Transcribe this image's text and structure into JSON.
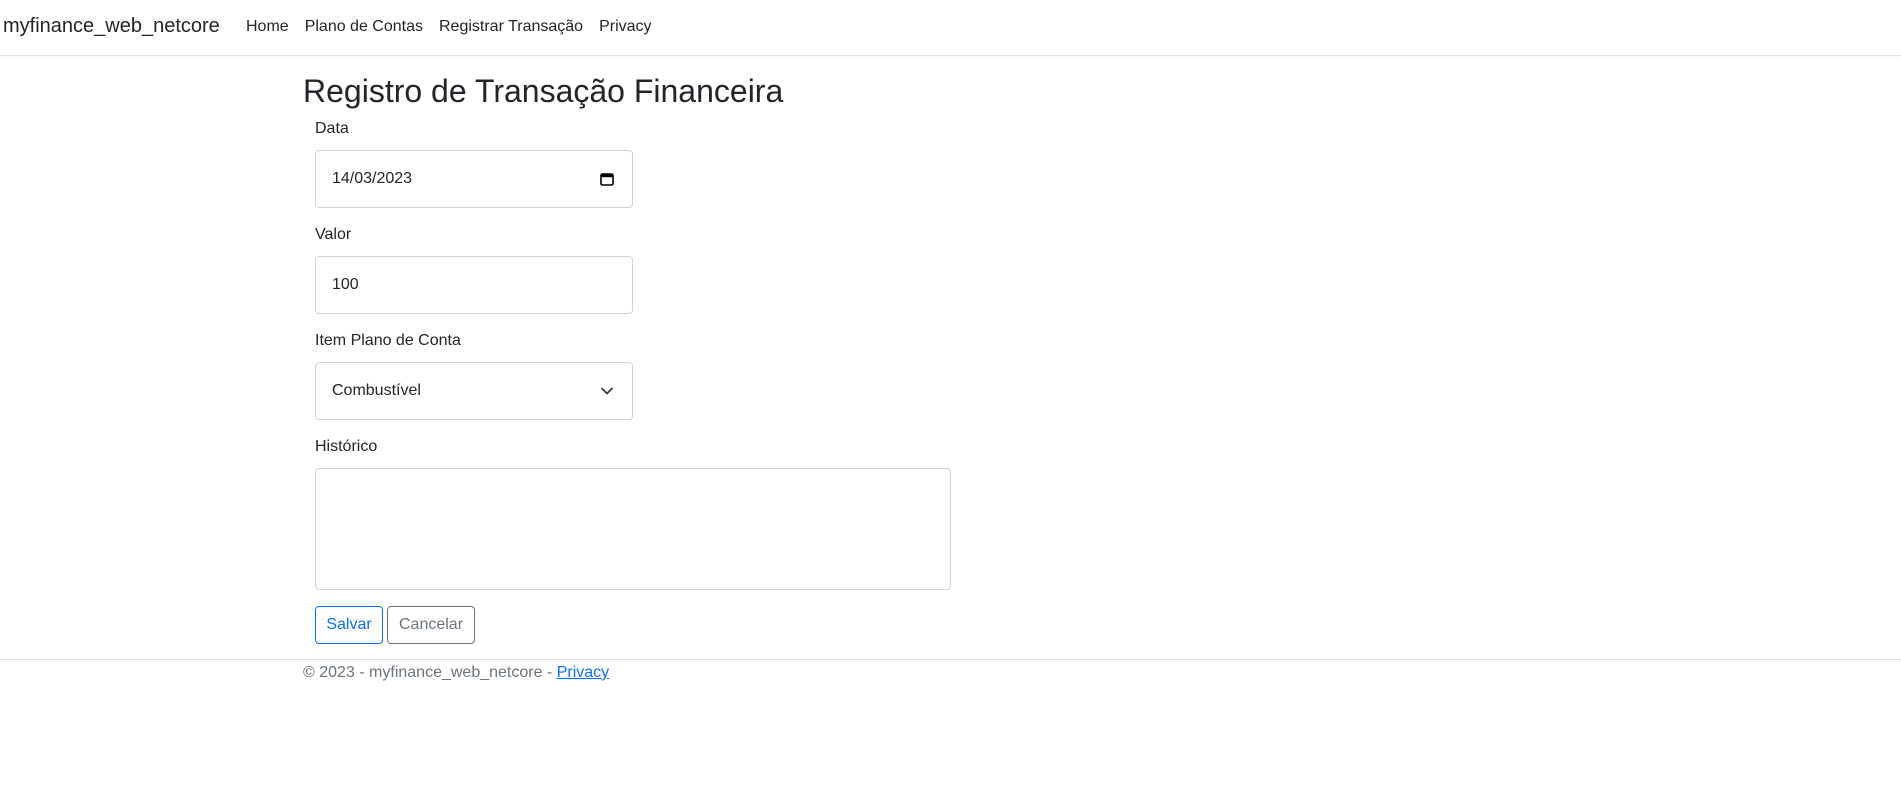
{
  "navbar": {
    "brand": "myfinance_web_netcore",
    "links": [
      {
        "label": "Home"
      },
      {
        "label": "Plano de Contas"
      },
      {
        "label": "Registrar Transação"
      },
      {
        "label": "Privacy"
      }
    ]
  },
  "page": {
    "title": "Registro de Transação Financeira"
  },
  "form": {
    "data": {
      "label": "Data",
      "value": "14/03/2023",
      "icon": "calendar-icon"
    },
    "valor": {
      "label": "Valor",
      "value": "100"
    },
    "item_plano_conta": {
      "label": "Item Plano de Conta",
      "selected": "Combustível",
      "icon": "chevron-down-icon"
    },
    "historico": {
      "label": "Histórico",
      "value": ""
    },
    "save_label": "Salvar",
    "cancel_label": "Cancelar"
  },
  "footer": {
    "copyright": "© 2023 - myfinance_web_netcore - ",
    "privacy_link": "Privacy"
  },
  "colors": {
    "primary": "#0d6efd",
    "secondary": "#6c757d",
    "text": "#212529",
    "border": "#ced4da"
  }
}
